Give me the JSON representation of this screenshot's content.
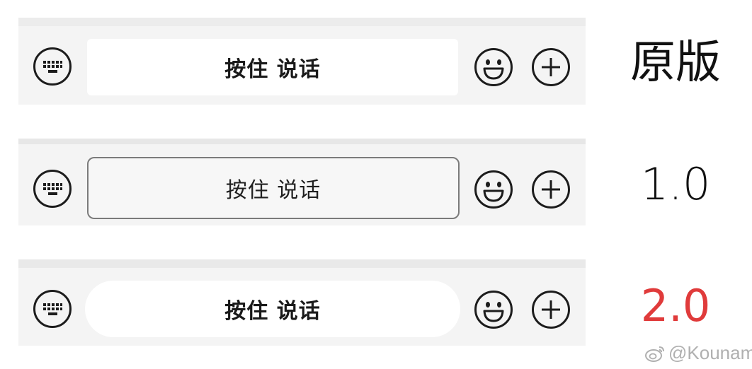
{
  "rows": [
    {
      "talk_label": "按住 说话",
      "version_label": "原版",
      "version_color": "#111111"
    },
    {
      "talk_label": "按住 说话",
      "version_label": "1.0",
      "version_color": "#111111"
    },
    {
      "talk_label": "按住 说话",
      "version_label": "2.0",
      "version_color": "#e03b3b"
    }
  ],
  "icons": {
    "keyboard": "keyboard-icon",
    "emoji": "smiley-icon",
    "add": "plus-circle-icon"
  },
  "watermark": {
    "text": "@Kounam",
    "icon": "weibo-logo"
  }
}
